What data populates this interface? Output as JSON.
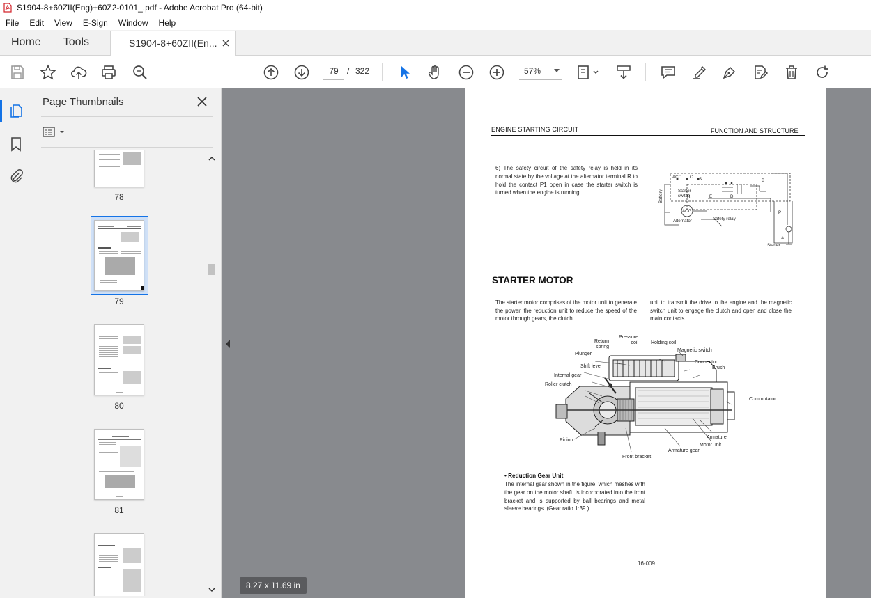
{
  "window": {
    "title": "S1904-8+60ZII(Eng)+60Z2-0101_.pdf - Adobe Acrobat Pro (64-bit)"
  },
  "menu": [
    "File",
    "Edit",
    "View",
    "E-Sign",
    "Window",
    "Help"
  ],
  "tabs": {
    "home": "Home",
    "tools": "Tools",
    "document": "S1904-8+60ZII(En..."
  },
  "toolbar": {
    "current_page": "79",
    "page_separator": "/",
    "total_pages": "322",
    "zoom": "57%"
  },
  "thumbnail_panel": {
    "title": "Page Thumbnails",
    "thumbnails": [
      {
        "label": "78"
      },
      {
        "label": "79",
        "selected": true
      },
      {
        "label": "80"
      },
      {
        "label": "81"
      }
    ]
  },
  "page_size_label": "8.27 x 11.69 in",
  "document_page": {
    "header_left": "ENGINE STARTING CIRCUIT",
    "header_right": "FUNCTION AND STRUCTURE",
    "item6": "6) The safety circuit of the safety relay is held in its normal state by the voltage at the alternator terminal R to hold the contact P1 open in case the starter switch is turned when the engine is running.",
    "circuit_labels": {
      "acc": "ACC",
      "c": "C",
      "s": "S",
      "b": "B",
      "starter_switch": "Starter\nswitch",
      "battery": "Battery",
      "acg": "ACG",
      "alternator": "Alternator",
      "safety_relay": "Safety relay",
      "starter": "Starter",
      "r": "R",
      "e": "E",
      "d": "D",
      "p": "P",
      "a": "A"
    },
    "section_title": "STARTER MOTOR",
    "intro_left": "The starter motor comprises of the motor unit to generate the power, the reduction unit to reduce the speed of the motor through gears, the clutch",
    "intro_right": "unit to transmit the drive to the engine and the magnetic switch unit to engage the clutch and open and close the main contacts.",
    "diagram_labels": {
      "return_spring": "Return\nspring",
      "pressure_coil": "Pressure\ncoil",
      "holding_coil": "Holding coil",
      "magnetic_switch": "Magnetic switch",
      "plunger": "Plunger",
      "shift_lever": "Shift lever",
      "connector": "Connector",
      "brush": "Brush",
      "internal_gear": "Internal gear",
      "roller_clutch": "Roller clutch",
      "commutator": "Commutator",
      "pinion": "Pinion",
      "armature": "Armature",
      "motor_unit": "Motor unit",
      "armature_gear": "Armature gear",
      "front_bracket": "Front bracket"
    },
    "reduction_title": "• Reduction Gear Unit",
    "reduction_body": "The internal gear shown in the figure, which meshes with the gear on the motor shaft, is incorporated into the front bracket and is supported by ball bearings and metal sleeve bearings. (Gear ratio 1:39.)",
    "page_number": "16-009"
  }
}
